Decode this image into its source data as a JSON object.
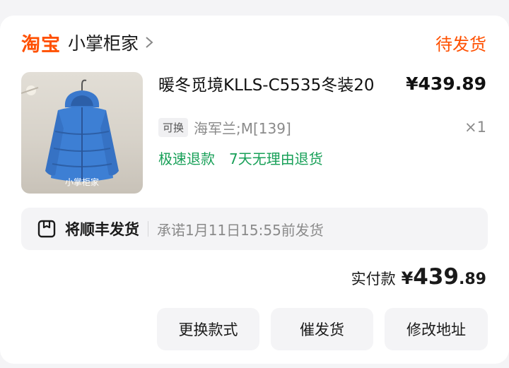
{
  "shop": {
    "platform_logo": "淘宝",
    "name": "小掌柜家",
    "status": "待发货"
  },
  "item": {
    "title": "暖冬觅境KLLS-C5535冬装20",
    "price": "¥439.89",
    "tag": "可换",
    "sku": "海军兰;M[139]",
    "quantity": "×1",
    "services": [
      "极速退款",
      "7天无理由退货"
    ],
    "image_watermark": "小掌柜家"
  },
  "shipping": {
    "label": "将顺丰发货",
    "promise": "承诺1月11日15:55前发货"
  },
  "payment": {
    "label": "实付款",
    "currency": "¥",
    "amount_int": "439",
    "amount_dec": ".89"
  },
  "actions": {
    "change_style": "更换款式",
    "urge_ship": "催发货",
    "edit_address": "修改地址"
  },
  "colors": {
    "accent": "#ff5000",
    "service_green": "#18a058",
    "muted": "#8a8a8a",
    "jacket_blue": "#3d7fd4"
  },
  "icons": [
    "chevron-right-icon",
    "package-box-icon"
  ]
}
